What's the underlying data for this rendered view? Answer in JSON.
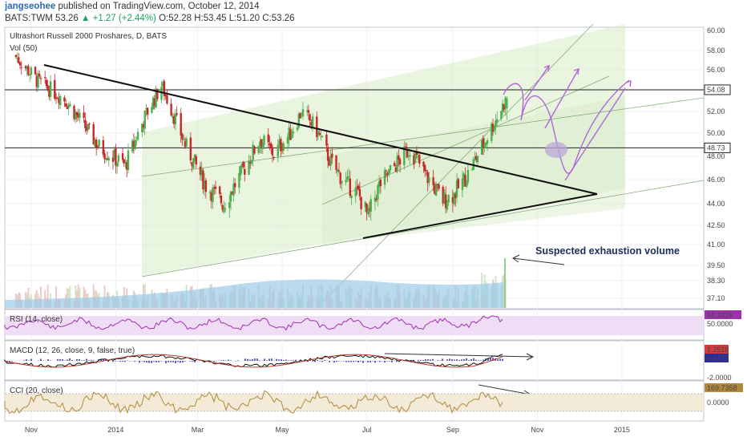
{
  "header": {
    "author": "jangseohee",
    "published": "published on TradingView.com, October 12, 2014",
    "symbol": "BATS:TWM",
    "last": "53.26",
    "change": "▲ +1.27 (+2.44%)",
    "open": "O:52.28",
    "high": "H:53.45",
    "low": "L:51.20",
    "close": "C:53.26"
  },
  "colors": {
    "up": "#4caf50",
    "down": "#c62828",
    "channel_fill": "#d8ecc6",
    "volume": "#bcd8ec",
    "vol_ma": "#9ccbe8",
    "rsi_band": "#eeddf4",
    "rsi_line": "#a030b0",
    "macd_line": "#111111",
    "signal_line": "#c0392b",
    "histogram": "#2d2d9c",
    "cci_band": "#f4ead8",
    "cci_line": "#b08a3c",
    "forecast_arrows": "#b066d8"
  },
  "chart_data": [
    {
      "type": "candlestick",
      "title": "Ultrashort Russell 2000 Proshares, D, BATS",
      "volume_label": "Vol (50)",
      "x_ticks": [
        "Nov",
        "2014",
        "Mar",
        "May",
        "Jul",
        "Sep",
        "Nov",
        "2015"
      ],
      "y_ticks": [
        "60.00",
        "58.00",
        "56.00",
        "54.00",
        "52.00",
        "50.00",
        "48.00",
        "46.00",
        "44.00",
        "42.50",
        "41.00",
        "39.50",
        "38.30",
        "37.10"
      ],
      "ylim": [
        37.1,
        60.0
      ],
      "price_tags": [
        "54.08",
        "48.73"
      ],
      "horizontal_levels": [
        54.08,
        48.73
      ],
      "key_closes": [
        {
          "x": "2013-10-20",
          "y": 57.5
        },
        {
          "x": "2013-11-05",
          "y": 55.0
        },
        {
          "x": "2013-11-25",
          "y": 53.2
        },
        {
          "x": "2013-12-20",
          "y": 48.8
        },
        {
          "x": "2014-01-08",
          "y": 47.2
        },
        {
          "x": "2014-01-22",
          "y": 51.5
        },
        {
          "x": "2014-02-03",
          "y": 54.5
        },
        {
          "x": "2014-02-20",
          "y": 49.0
        },
        {
          "x": "2014-03-07",
          "y": 45.5
        },
        {
          "x": "2014-03-20",
          "y": 44.0
        },
        {
          "x": "2014-04-04",
          "y": 47.0
        },
        {
          "x": "2014-04-15",
          "y": 49.5
        },
        {
          "x": "2014-04-25",
          "y": 48.2
        },
        {
          "x": "2014-05-07",
          "y": 50.0
        },
        {
          "x": "2014-05-15",
          "y": 52.0
        },
        {
          "x": "2014-05-25",
          "y": 50.5
        },
        {
          "x": "2014-06-05",
          "y": 47.5
        },
        {
          "x": "2014-06-15",
          "y": 45.8
        },
        {
          "x": "2014-06-25",
          "y": 44.8
        },
        {
          "x": "2014-07-02",
          "y": 43.0
        },
        {
          "x": "2014-07-10",
          "y": 45.5
        },
        {
          "x": "2014-07-20",
          "y": 47.0
        },
        {
          "x": "2014-08-01",
          "y": 48.7
        },
        {
          "x": "2014-08-12",
          "y": 46.5
        },
        {
          "x": "2014-08-25",
          "y": 44.3
        },
        {
          "x": "2014-09-02",
          "y": 44.8
        },
        {
          "x": "2014-09-12",
          "y": 46.5
        },
        {
          "x": "2014-09-25",
          "y": 49.5
        },
        {
          "x": "2014-10-03",
          "y": 51.5
        },
        {
          "x": "2014-10-10",
          "y": 53.26
        }
      ],
      "annotation": "Suspected exhaustion volume"
    },
    {
      "type": "line",
      "title": "RSI (14, close)",
      "y_ticks": [
        "50.0000"
      ],
      "last_value": "68.2426",
      "ylim": [
        20,
        80
      ]
    },
    {
      "type": "line",
      "title": "MACD (12, 26, close, 9, false, true)",
      "series": [
        {
          "name": "MACD"
        },
        {
          "name": "Signal"
        },
        {
          "name": "Histogram"
        }
      ],
      "last_values": [
        "1.2518",
        "0.4132"
      ],
      "y_ticks": [
        "-2.0000"
      ],
      "ylim": [
        -2.5,
        2.5
      ]
    },
    {
      "type": "line",
      "title": "CCI (20, close)",
      "y_ticks": [
        "0.0000"
      ],
      "last_value": "169.7358",
      "ylim": [
        -250,
        250
      ]
    }
  ]
}
